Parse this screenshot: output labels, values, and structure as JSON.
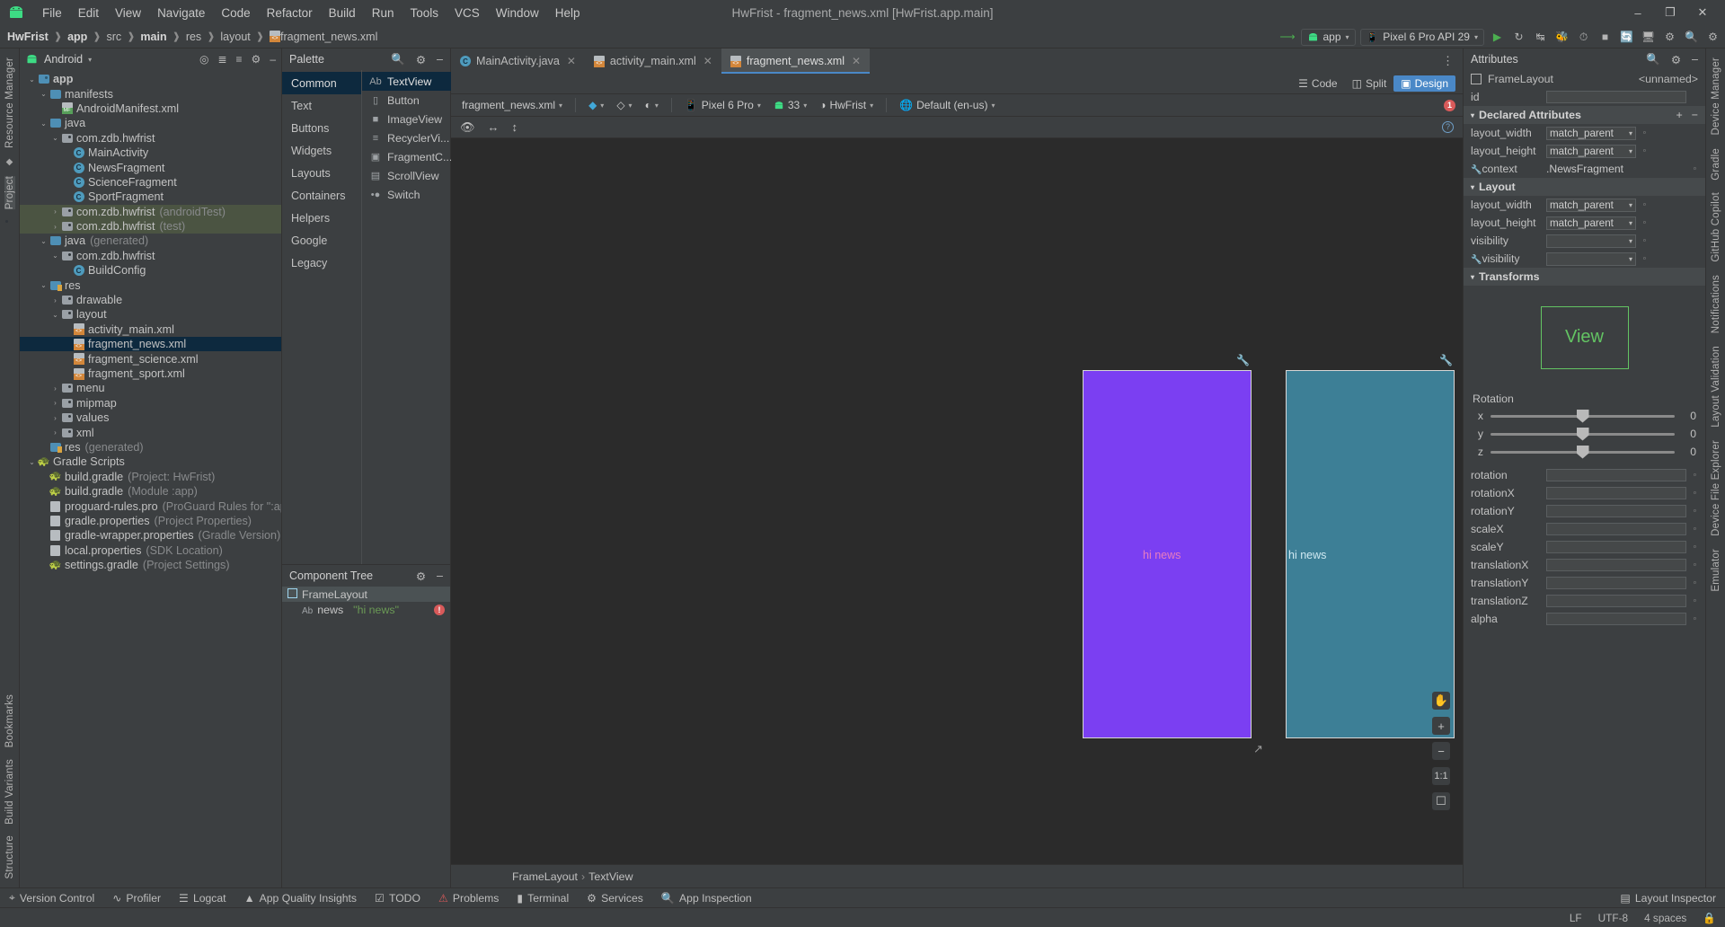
{
  "window": {
    "title": "HwFrist - fragment_news.xml [HwFrist.app.main]",
    "minimize": "–",
    "maximize": "❐",
    "close": "✕"
  },
  "menu": [
    "File",
    "Edit",
    "View",
    "Navigate",
    "Code",
    "Refactor",
    "Build",
    "Run",
    "Tools",
    "VCS",
    "Window",
    "Help"
  ],
  "breadcrumb": [
    "HwFrist",
    "app",
    "src",
    "main",
    "res",
    "layout",
    "fragment_news.xml"
  ],
  "toolbar": {
    "run_config": "app",
    "device": "Pixel 6 Pro API 29",
    "caret": "▾"
  },
  "project_panel": {
    "title": "Android",
    "tree": [
      {
        "indent": 0,
        "arrow": "⌄",
        "icon": "module",
        "label": "app",
        "bold": true
      },
      {
        "indent": 1,
        "arrow": "⌄",
        "icon": "folder-blue",
        "label": "manifests"
      },
      {
        "indent": 2,
        "arrow": "",
        "icon": "manifest",
        "label": "AndroidManifest.xml"
      },
      {
        "indent": 1,
        "arrow": "⌄",
        "icon": "folder-blue",
        "label": "java"
      },
      {
        "indent": 2,
        "arrow": "⌄",
        "icon": "package",
        "label": "com.zdb.hwfrist"
      },
      {
        "indent": 3,
        "arrow": "",
        "icon": "class",
        "label": "MainActivity"
      },
      {
        "indent": 3,
        "arrow": "",
        "icon": "class",
        "label": "NewsFragment"
      },
      {
        "indent": 3,
        "arrow": "",
        "icon": "class",
        "label": "ScienceFragment"
      },
      {
        "indent": 3,
        "arrow": "",
        "icon": "class",
        "label": "SportFragment"
      },
      {
        "indent": 2,
        "arrow": "›",
        "icon": "package",
        "label": "com.zdb.hwfrist",
        "suffix": "(androidTest)",
        "state": "green"
      },
      {
        "indent": 2,
        "arrow": "›",
        "icon": "package",
        "label": "com.zdb.hwfrist",
        "suffix": "(test)",
        "state": "green"
      },
      {
        "indent": 1,
        "arrow": "⌄",
        "icon": "folder-gen",
        "label": "java",
        "suffix": "(generated)"
      },
      {
        "indent": 2,
        "arrow": "⌄",
        "icon": "package",
        "label": "com.zdb.hwfrist"
      },
      {
        "indent": 3,
        "arrow": "",
        "icon": "class-gen",
        "label": "BuildConfig"
      },
      {
        "indent": 1,
        "arrow": "⌄",
        "icon": "folder-res",
        "label": "res"
      },
      {
        "indent": 2,
        "arrow": "›",
        "icon": "package",
        "label": "drawable"
      },
      {
        "indent": 2,
        "arrow": "⌄",
        "icon": "package",
        "label": "layout"
      },
      {
        "indent": 3,
        "arrow": "",
        "icon": "xml",
        "label": "activity_main.xml"
      },
      {
        "indent": 3,
        "arrow": "",
        "icon": "xml",
        "label": "fragment_news.xml",
        "state": "selected"
      },
      {
        "indent": 3,
        "arrow": "",
        "icon": "xml",
        "label": "fragment_science.xml"
      },
      {
        "indent": 3,
        "arrow": "",
        "icon": "xml",
        "label": "fragment_sport.xml"
      },
      {
        "indent": 2,
        "arrow": "›",
        "icon": "package",
        "label": "menu"
      },
      {
        "indent": 2,
        "arrow": "›",
        "icon": "package",
        "label": "mipmap"
      },
      {
        "indent": 2,
        "arrow": "›",
        "icon": "package",
        "label": "values"
      },
      {
        "indent": 2,
        "arrow": "›",
        "icon": "package",
        "label": "xml"
      },
      {
        "indent": 1,
        "arrow": "",
        "icon": "folder-res",
        "label": "res",
        "suffix": "(generated)"
      },
      {
        "indent": 0,
        "arrow": "⌄",
        "icon": "gradle",
        "label": "Gradle Scripts"
      },
      {
        "indent": 1,
        "arrow": "",
        "icon": "gradle",
        "label": "build.gradle",
        "suffix": "(Project: HwFrist)"
      },
      {
        "indent": 1,
        "arrow": "",
        "icon": "gradle",
        "label": "build.gradle",
        "suffix": "(Module :app)"
      },
      {
        "indent": 1,
        "arrow": "",
        "icon": "props",
        "label": "proguard-rules.pro",
        "suffix": "(ProGuard Rules for \":app\")"
      },
      {
        "indent": 1,
        "arrow": "",
        "icon": "props",
        "label": "gradle.properties",
        "suffix": "(Project Properties)"
      },
      {
        "indent": 1,
        "arrow": "",
        "icon": "props",
        "label": "gradle-wrapper.properties",
        "suffix": "(Gradle Version)"
      },
      {
        "indent": 1,
        "arrow": "",
        "icon": "props",
        "label": "local.properties",
        "suffix": "(SDK Location)"
      },
      {
        "indent": 1,
        "arrow": "",
        "icon": "gradle",
        "label": "settings.gradle",
        "suffix": "(Project Settings)"
      }
    ]
  },
  "left_rail": [
    "Resource Manager",
    "Project",
    "Bookmarks",
    "Build Variants",
    "Structure"
  ],
  "right_rail": [
    "Device Manager",
    "Gradle",
    "GitHub Copilot",
    "Notifications",
    "Layout Validation",
    "Device File Explorer",
    "Emulator"
  ],
  "tabs": [
    {
      "label": "MainActivity.java",
      "icon": "class",
      "active": false
    },
    {
      "label": "activity_main.xml",
      "icon": "xml",
      "active": false
    },
    {
      "label": "fragment_news.xml",
      "icon": "xml",
      "active": true
    }
  ],
  "mode_bar": {
    "code": "Code",
    "split": "Split",
    "design": "Design",
    "selected": "Design"
  },
  "palette": {
    "title": "Palette",
    "categories": [
      "Common",
      "Text",
      "Buttons",
      "Widgets",
      "Layouts",
      "Containers",
      "Helpers",
      "Google",
      "Legacy"
    ],
    "selected_category": "Common",
    "items": [
      {
        "label": "TextView",
        "icon": "Ab",
        "selected": true
      },
      {
        "label": "Button",
        "icon": "button"
      },
      {
        "label": "ImageView",
        "icon": "image"
      },
      {
        "label": "RecyclerVi...",
        "icon": "list"
      },
      {
        "label": "FragmentC...",
        "icon": "fragment"
      },
      {
        "label": "ScrollView",
        "icon": "scroll"
      },
      {
        "label": "Switch",
        "icon": "switch"
      }
    ]
  },
  "component_tree": {
    "title": "Component Tree",
    "rows": [
      {
        "label": "FrameLayout",
        "icon": "frame",
        "selected": true,
        "value": ""
      },
      {
        "label": "news",
        "icon": "Ab",
        "selected": false,
        "value": "\"hi news\"",
        "badge": "!"
      }
    ]
  },
  "design_toolbar": {
    "file": "fragment_news.xml",
    "device": "Pixel 6 Pro",
    "api": "33",
    "theme": "HwFrist",
    "locale": "Default (en-us)",
    "error_count": "1"
  },
  "canvas": {
    "device_label_1": "hi news",
    "device_label_2": "hi news",
    "zoom_controls": [
      "pan",
      "+",
      "–",
      "1:1",
      "fit"
    ]
  },
  "editor_footer": {
    "parent": "FrameLayout",
    "child": "TextView",
    "sep": "›"
  },
  "attributes": {
    "title": "Attributes",
    "component_type": "FrameLayout",
    "component_id": "<unnamed>",
    "id_label": "id",
    "id_value": "",
    "declared_section": "Declared Attributes",
    "declared": [
      {
        "name": "layout_width",
        "value": "match_parent",
        "dropdown": true
      },
      {
        "name": "layout_height",
        "value": "match_parent",
        "dropdown": true
      },
      {
        "name": "context",
        "value": ".NewsFragment",
        "wrench": true
      }
    ],
    "layout_section": "Layout",
    "layout": [
      {
        "name": "layout_width",
        "value": "match_parent",
        "dropdown": true
      },
      {
        "name": "layout_height",
        "value": "match_parent",
        "dropdown": true
      },
      {
        "name": "visibility",
        "value": "",
        "dropdown": true
      },
      {
        "name": "visibility",
        "value": "",
        "dropdown": true,
        "wrench": true
      }
    ],
    "transforms_section": "Transforms",
    "preview_text": "View",
    "rotation_label": "Rotation",
    "rotation": [
      {
        "axis": "x",
        "value": "0"
      },
      {
        "axis": "y",
        "value": "0"
      },
      {
        "axis": "z",
        "value": "0"
      }
    ],
    "fields": [
      "rotation",
      "rotationX",
      "rotationY",
      "scaleX",
      "scaleY",
      "translationX",
      "translationY",
      "translationZ",
      "alpha"
    ]
  },
  "tool_windows": [
    {
      "label": "Version Control",
      "icon": "branch"
    },
    {
      "label": "Profiler",
      "icon": "profiler"
    },
    {
      "label": "Logcat",
      "icon": "logcat"
    },
    {
      "label": "App Quality Insights",
      "icon": "insights"
    },
    {
      "label": "TODO",
      "icon": "todo"
    },
    {
      "label": "Problems",
      "icon": "problems"
    },
    {
      "label": "Terminal",
      "icon": "terminal"
    },
    {
      "label": "Services",
      "icon": "services"
    },
    {
      "label": "App Inspection",
      "icon": "inspection"
    }
  ],
  "tool_windows_right": [
    {
      "label": "Layout Inspector",
      "icon": "layout-inspector"
    }
  ],
  "status_bar": {
    "line_ending": "LF",
    "encoding": "UTF-8",
    "indent": "4 spaces"
  }
}
